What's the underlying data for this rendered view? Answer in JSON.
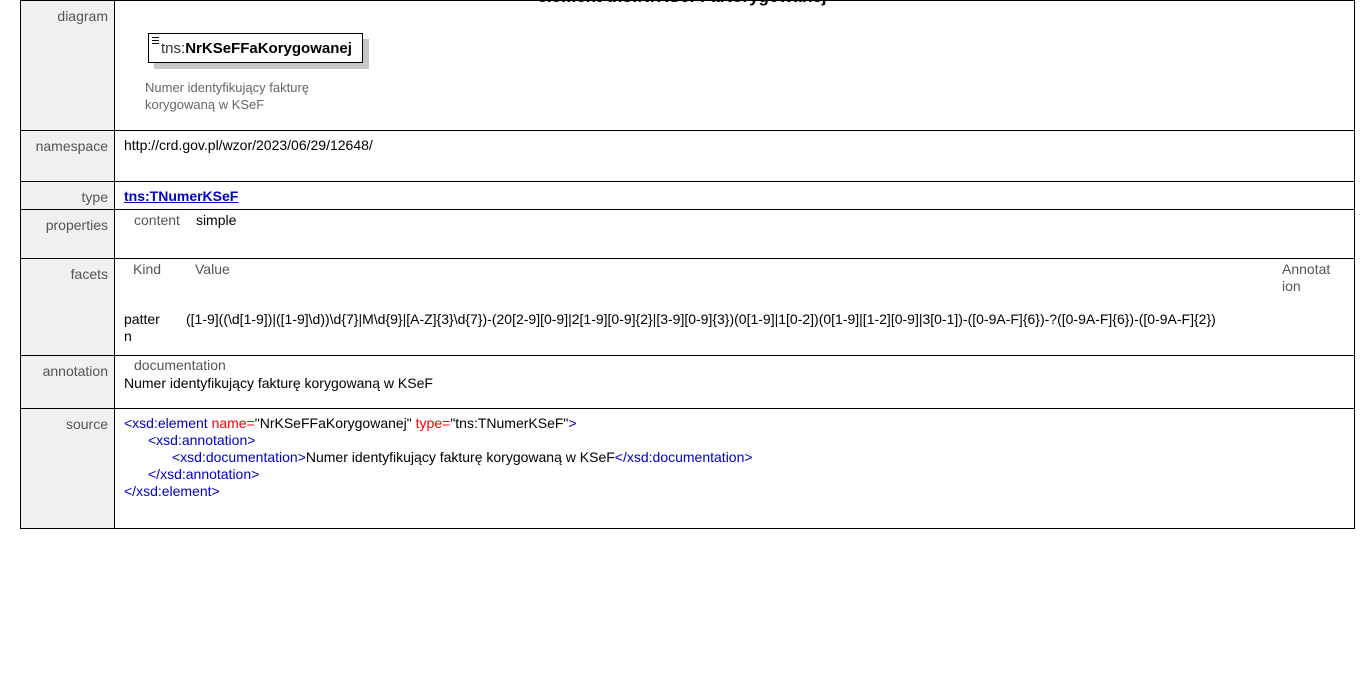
{
  "page_heading": "element tns:NrKSeFFaKorygowanej",
  "rows": {
    "diagram": {
      "label": "diagram",
      "element_prefix": "tns:",
      "element_name": "NrKSeFFaKorygowanej",
      "doc_text": "Numer identyfikujący fakturę korygowaną w KSeF"
    },
    "namespace": {
      "label": "namespace",
      "value": "http://crd.gov.pl/wzor/2023/06/29/12648/"
    },
    "type": {
      "label": "type",
      "value": "tns:TNumerKSeF"
    },
    "properties": {
      "label": "properties",
      "key": "content",
      "value": "simple"
    },
    "facets": {
      "label": "facets",
      "header_kind": "Kind",
      "header_value": "Value",
      "header_annotation": "Annotation",
      "kind": "pattern",
      "value": "([1-9]((\\d[1-9])|([1-9]\\d))\\d{7}|M\\d{9}|[A-Z]{3}\\d{7})-(20[2-9][0-9]|2[1-9][0-9]{2}|[3-9][0-9]{3})(0[1-9]|1[0-2])(0[1-9]|[1-2][0-9]|3[0-1])-([0-9A-F]{6})-?([0-9A-F]{6})-([0-9A-F]{2})"
    },
    "annotation": {
      "label": "annotation",
      "key": "documentation",
      "value": "Numer identyfikujący fakturę korygowaną w KSeF"
    },
    "source": {
      "label": "source",
      "line1_open": "<xsd:element ",
      "line1_attr1": "name=",
      "line1_val1": "\"NrKSeFFaKorygowanej\"",
      "line1_attr2": " type=",
      "line1_val2": "\"tns:TNumerKSeF\"",
      "line1_close": ">",
      "line2": "<xsd:annotation>",
      "line3_open": "<xsd:documentation>",
      "line3_text": "Numer identyfikujący fakturę korygowaną w KSeF",
      "line3_close": "</xsd:documentation>",
      "line4": "</xsd:annotation>",
      "line5": "</xsd:element>"
    }
  }
}
